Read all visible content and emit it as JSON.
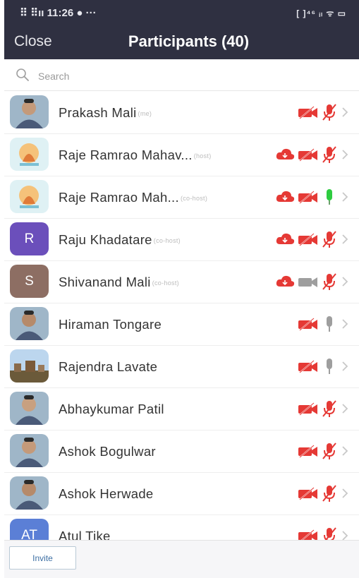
{
  "status_bar": {
    "left": "⠿ ⠿ıı 11:26 ● ···",
    "right": "[ ]⁴⁶ ᵢₗ ᯤ ▭"
  },
  "header": {
    "close_label": "Close",
    "title": "Participants (40)"
  },
  "search": {
    "placeholder": "Search"
  },
  "participants": [
    {
      "name": "Prakash Mali",
      "role": "(me)",
      "avatar": "photo",
      "icons": [
        "video-off",
        "mic-off",
        "chevron"
      ]
    },
    {
      "name": "Raje Ramrao Mahav...",
      "role": "(host)",
      "avatar": "emblem",
      "icons": [
        "cloud",
        "video-off",
        "mic-off",
        "chevron"
      ]
    },
    {
      "name": "Raje Ramrao Mah...",
      "role": "(co-host)",
      "avatar": "emblem",
      "icons": [
        "cloud",
        "video-off",
        "mic-on",
        "chevron"
      ]
    },
    {
      "name": "Raju Khadatare",
      "role": "(co-host)",
      "avatar": "letter",
      "letter": "R",
      "avatar_color": "#6b4fbb",
      "icons": [
        "cloud",
        "video-off",
        "mic-off",
        "chevron"
      ]
    },
    {
      "name": "Shivanand Mali",
      "role": "(co-host)",
      "avatar": "letter",
      "letter": "S",
      "avatar_color": "#8d6e63",
      "icons": [
        "cloud",
        "video-on",
        "mic-off",
        "chevron"
      ]
    },
    {
      "name": "Hiraman Tongare",
      "role": "",
      "avatar": "photo",
      "icons": [
        "video-off",
        "mic-muted-gray",
        "chevron"
      ]
    },
    {
      "name": "Rajendra Lavate",
      "role": "",
      "avatar": "landscape",
      "icons": [
        "video-off",
        "mic-muted-gray",
        "chevron"
      ]
    },
    {
      "name": "Abhaykumar Patil",
      "role": "",
      "avatar": "photo",
      "icons": [
        "video-off",
        "mic-off",
        "chevron"
      ]
    },
    {
      "name": "Ashok Bogulwar",
      "role": "",
      "avatar": "photo",
      "icons": [
        "video-off",
        "mic-off",
        "chevron"
      ]
    },
    {
      "name": "Ashok Herwade",
      "role": "",
      "avatar": "photo",
      "icons": [
        "video-off",
        "mic-off",
        "chevron"
      ]
    },
    {
      "name": "Atul Tike",
      "role": "",
      "avatar": "letter",
      "letter": "AT",
      "avatar_color": "#5b7fd6",
      "icons": [
        "video-off",
        "mic-off",
        "chevron"
      ]
    }
  ],
  "footer": {
    "invite_label": "Invite"
  },
  "colors": {
    "header_bg": "#2f3041",
    "alert_red": "#e53935",
    "mic_green": "#2ecc40",
    "gray_icon": "#9e9e9e"
  }
}
